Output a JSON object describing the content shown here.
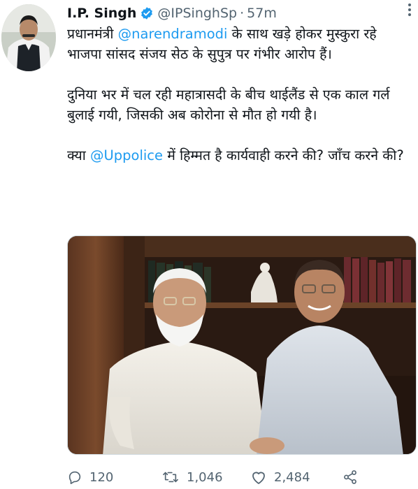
{
  "author": {
    "name": "I.P. Singh",
    "handle": "@IPSinghSp",
    "separator": "·",
    "time": "57m"
  },
  "tweet": {
    "p1_part1": "प्रधानमंत्री ",
    "p1_mention": "@narendramodi",
    "p1_part2": " के साथ खड़े होकर मुस्कुरा रहे भाजपा सांसद संजय सेठ के सुपुत्र पर गंभीर आरोप हैं।",
    "p2": "दुनिया भर में चल रही महात्रासदी के बीच थाईलैंड से एक काल गर्ल बुलाई गयी, जिसकी अब कोरोना से मौत हो गयी है।",
    "p3_part1": "क्या ",
    "p3_mention": "@Uppolice",
    "p3_part2": " में हिम्मत है कार्यवाही करने की? जाँच करने की?"
  },
  "actions": {
    "replies": "120",
    "retweets": "1,046",
    "likes": "2,484"
  },
  "colors": {
    "accent": "#1d9bf0",
    "text": "#0f1419",
    "muted": "#536471"
  }
}
